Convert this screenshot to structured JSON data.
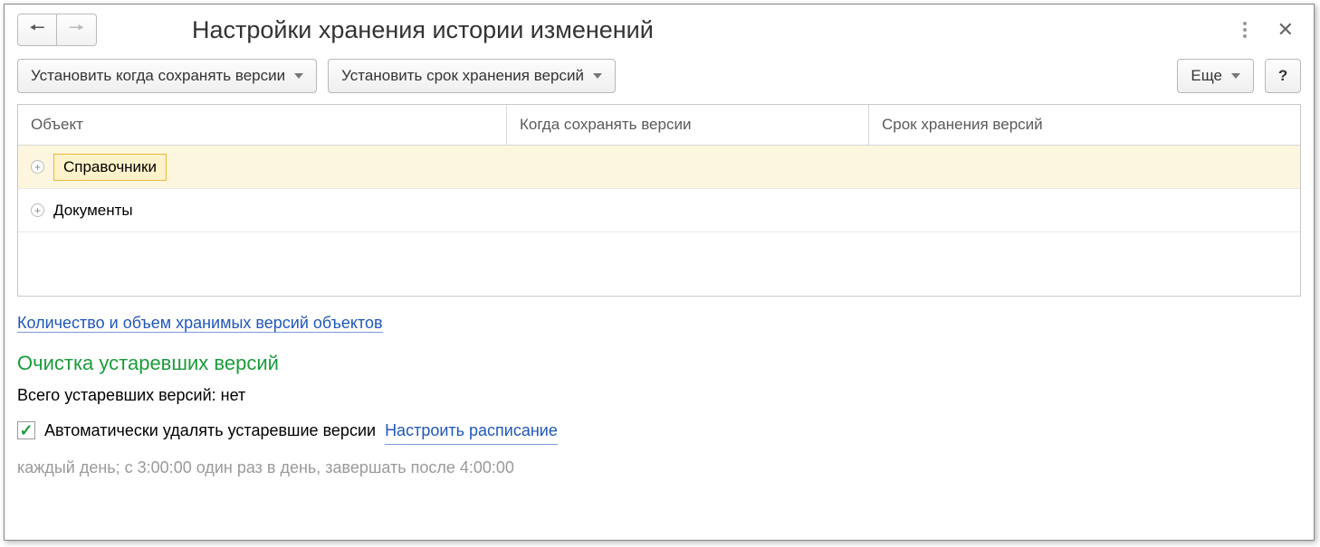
{
  "header": {
    "title": "Настройки хранения истории изменений"
  },
  "toolbar": {
    "set_when_label": "Установить когда сохранять версии",
    "set_term_label": "Установить срок хранения версий",
    "more_label": "Еще",
    "help_label": "?"
  },
  "table": {
    "columns": {
      "object": "Объект",
      "when": "Когда сохранять версии",
      "term": "Срок хранения версий"
    },
    "rows": [
      {
        "label": "Справочники",
        "when": "",
        "term": "",
        "selected": true
      },
      {
        "label": "Документы",
        "when": "",
        "term": "",
        "selected": false
      }
    ]
  },
  "footer": {
    "link_count": "Количество и объем хранимых версий объектов",
    "section_title": "Очистка устаревших версий",
    "total_obsolete_label": "Всего устаревших версий:",
    "total_obsolete_value": "нет",
    "auto_delete_label": "Автоматически удалять устаревшие версии",
    "configure_schedule": "Настроить расписание",
    "schedule_text": "каждый день; с 3:00:00 один раз в день, завершать после 4:00:00"
  }
}
